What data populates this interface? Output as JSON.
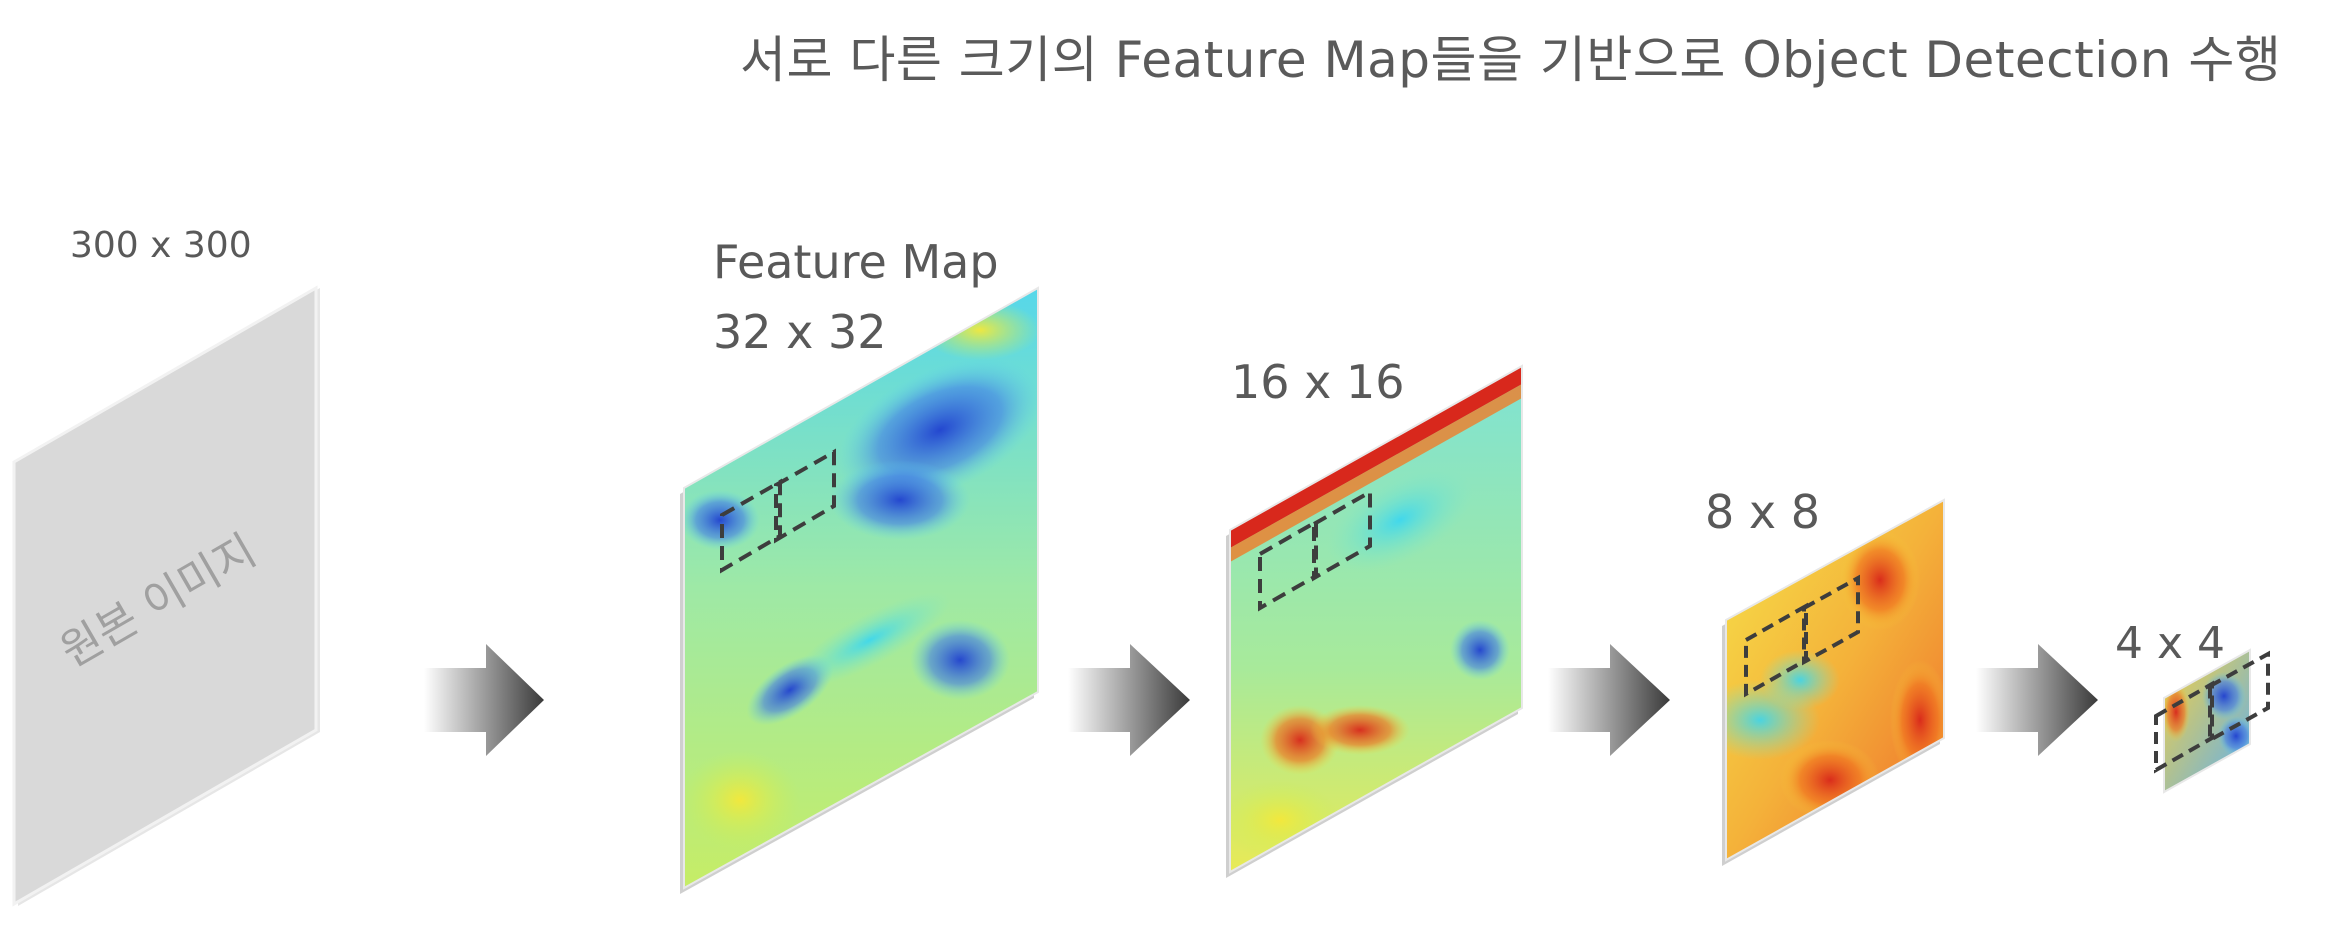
{
  "title": "서로 다른 크기의  Feature Map들을 기반으로 Object Detection 수행",
  "input_image": {
    "size_label": "300 x 300",
    "caption": "원본 이미지"
  },
  "feature_maps": [
    {
      "heading": "Feature Map",
      "size_label": "32 x 32"
    },
    {
      "size_label": "16 x 16"
    },
    {
      "size_label": "8 x 8"
    },
    {
      "size_label": "4 x 4"
    }
  ],
  "colors": {
    "arrow_dark": "#3a3a3a",
    "arrow_light": "#ffffff",
    "input_plane": "#d9d9d9",
    "box_stroke": "#3d3d3d",
    "heat_low": "#1f4fd8",
    "heat_mid": "#7ee6c8",
    "heat_high": "#e0281e"
  }
}
